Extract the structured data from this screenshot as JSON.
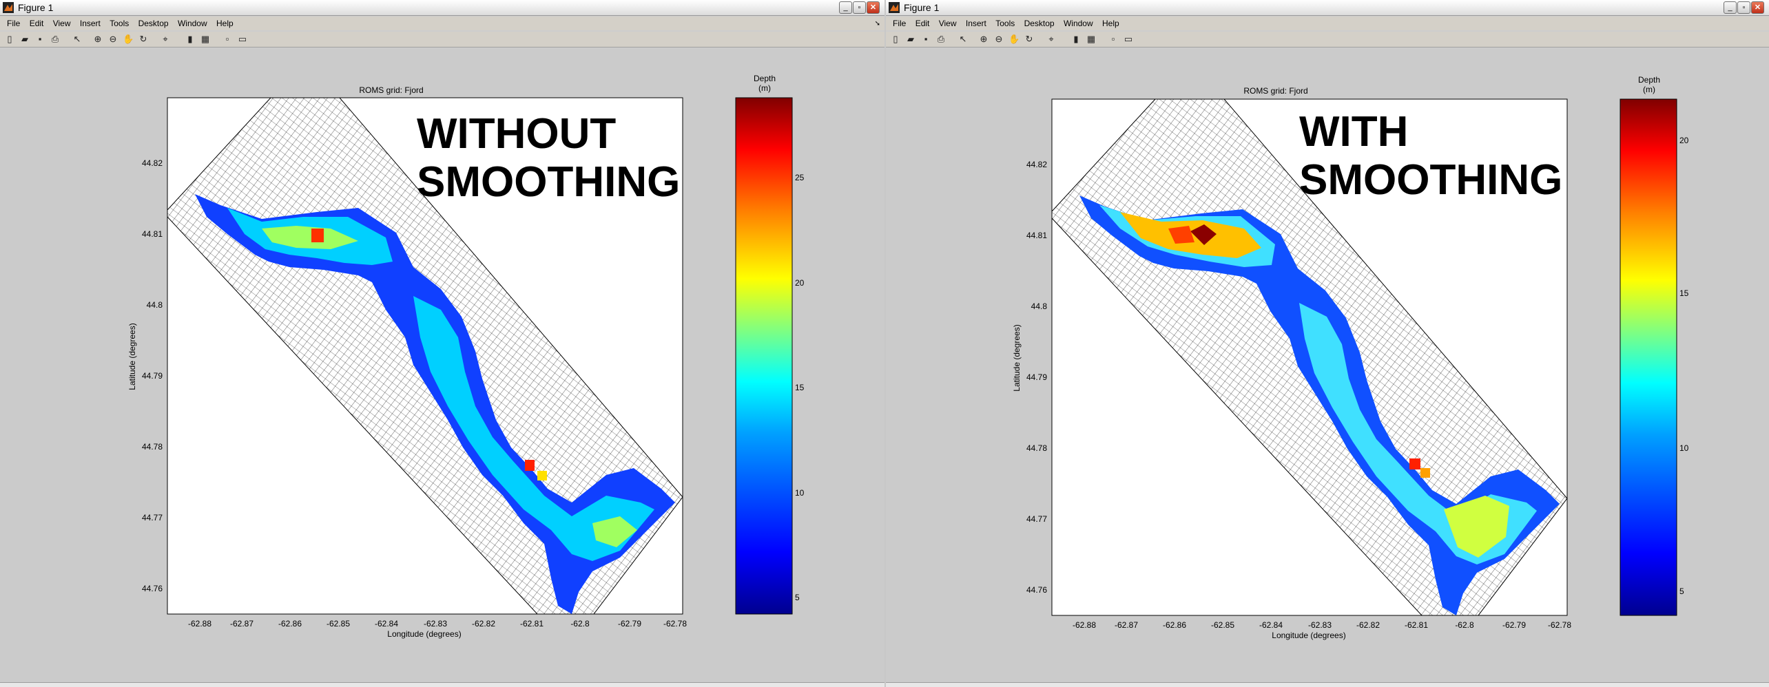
{
  "left": {
    "window_title": "Figure 1",
    "menu": [
      "File",
      "Edit",
      "View",
      "Insert",
      "Tools",
      "Desktop",
      "Window",
      "Help"
    ],
    "axes_title": "ROMS grid: Fjord",
    "xlabel": "Longitude (degrees)",
    "ylabel": "Latitude (degrees)",
    "x_ticks": [
      "-62.88",
      "-62.87",
      "-62.86",
      "-62.85",
      "-62.84",
      "-62.83",
      "-62.82",
      "-62.81",
      "-62.8",
      "-62.79",
      "-62.78"
    ],
    "y_ticks": [
      "44.82",
      "44.81",
      "44.8",
      "44.79",
      "44.78",
      "44.77",
      "44.76"
    ],
    "overlay_line1": "WITHOUT",
    "overlay_line2": "SMOOTHING",
    "colorbar_title_line1": "Depth",
    "colorbar_title_line2": "(m)",
    "colorbar_ticks": [
      "25",
      "20",
      "15",
      "10",
      "5"
    ]
  },
  "right": {
    "window_title": "Figure 1",
    "menu": [
      "File",
      "Edit",
      "View",
      "Insert",
      "Tools",
      "Desktop",
      "Window",
      "Help"
    ],
    "axes_title": "ROMS grid: Fjord",
    "xlabel": "Longitude (degrees)",
    "ylabel": "Latitude (degrees)",
    "x_ticks": [
      "-62.88",
      "-62.87",
      "-62.86",
      "-62.85",
      "-62.84",
      "-62.83",
      "-62.82",
      "-62.81",
      "-62.8",
      "-62.79",
      "-62.78"
    ],
    "y_ticks": [
      "44.82",
      "44.81",
      "44.8",
      "44.79",
      "44.78",
      "44.77",
      "44.76"
    ],
    "overlay_line1": "WITH",
    "overlay_line2": "SMOOTHING",
    "colorbar_title_line1": "Depth",
    "colorbar_title_line2": "(m)",
    "colorbar_ticks": [
      "20",
      "15",
      "10",
      "5"
    ]
  },
  "colors": {
    "close_button": "#c0301a",
    "colormap": [
      "#00008f",
      "#0000ff",
      "#00a0ff",
      "#00ffff",
      "#80ff80",
      "#ffff00",
      "#ff8000",
      "#ff0000",
      "#800000"
    ]
  }
}
